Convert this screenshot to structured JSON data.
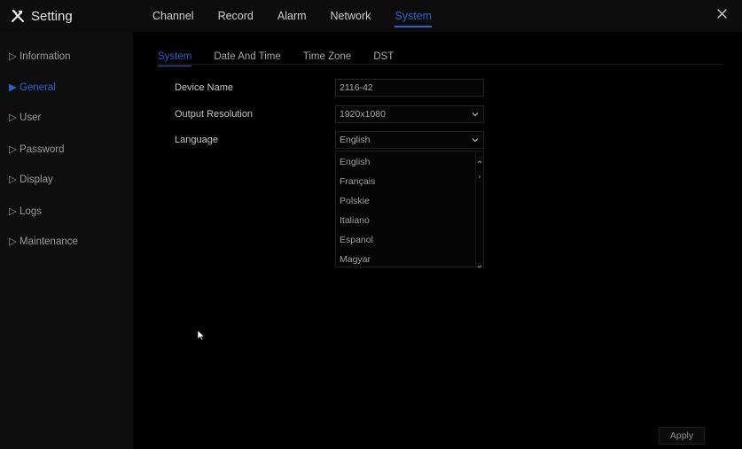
{
  "app": {
    "title": "Setting",
    "icon": "tools-icon"
  },
  "main_tabs": [
    {
      "label": "Channel",
      "active": false
    },
    {
      "label": "Record",
      "active": false
    },
    {
      "label": "Alarm",
      "active": false
    },
    {
      "label": "Network",
      "active": false
    },
    {
      "label": "System",
      "active": true
    }
  ],
  "close_icon": "close-icon",
  "sidebar": {
    "items": [
      {
        "label": "▷ Information",
        "active": false
      },
      {
        "label": "▶ General",
        "active": true
      },
      {
        "label": "▷ User",
        "active": false
      },
      {
        "label": "▷ Password",
        "active": false
      },
      {
        "label": "▷ Display",
        "active": false
      },
      {
        "label": "▷ Logs",
        "active": false
      },
      {
        "label": "▷ Maintenance",
        "active": false
      }
    ]
  },
  "sub_tabs": [
    {
      "label": "System",
      "active": true
    },
    {
      "label": "Date And Time",
      "active": false
    },
    {
      "label": "Time Zone",
      "active": false
    },
    {
      "label": "DST",
      "active": false
    }
  ],
  "form": {
    "device_name": {
      "label": "Device Name",
      "value": "2116-42"
    },
    "output_resolution": {
      "label": "Output Resolution",
      "value": "1920x1080"
    },
    "language": {
      "label": "Language",
      "value": "English"
    }
  },
  "language_options": [
    "English",
    "Français",
    "Polskie",
    "Italiano",
    "Espanol",
    "Magyar"
  ],
  "apply_label": "Apply",
  "colors": {
    "accent": "#2b63c9",
    "background": "#000000",
    "sidebar": "#0e0e0f",
    "topbar": "#0c0c0d"
  }
}
